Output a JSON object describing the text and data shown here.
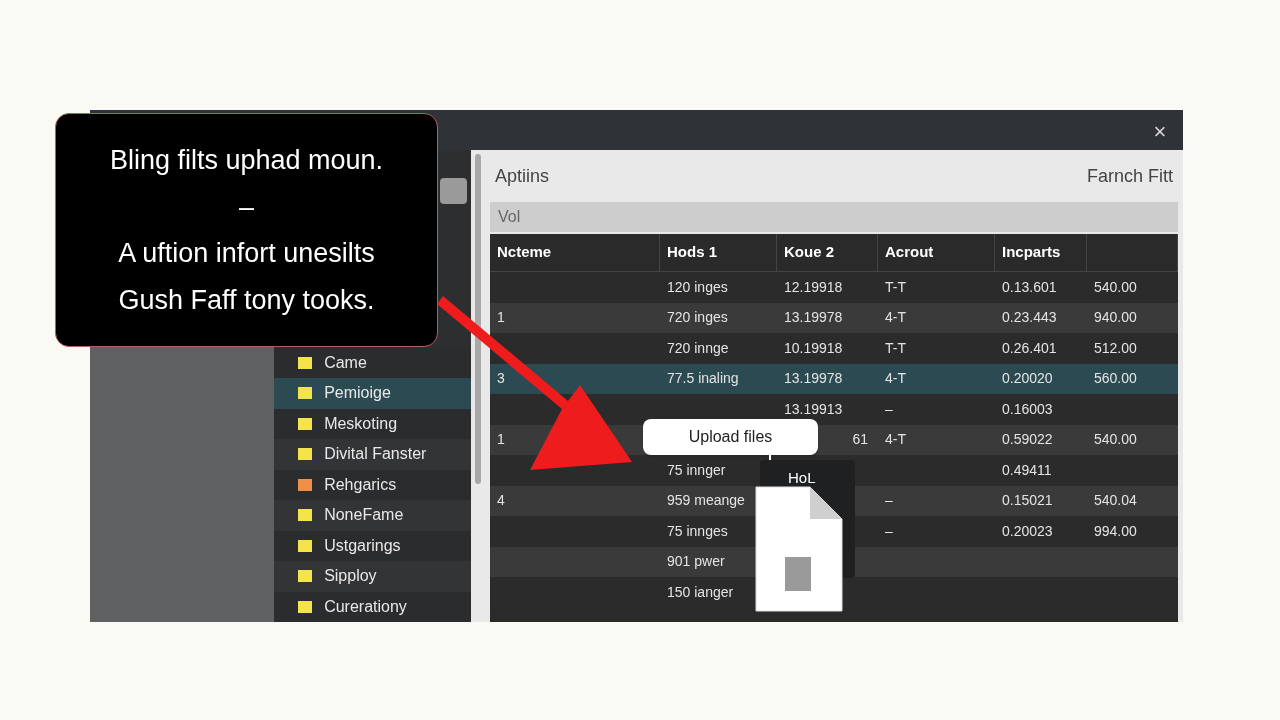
{
  "window": {
    "close": "×"
  },
  "sidebar": {
    "items": [
      {
        "label": "Came",
        "color": "#f2e44a",
        "selected": false
      },
      {
        "label": "Pemioige",
        "color": "#f2e44a",
        "selected": true
      },
      {
        "label": "Meskoting",
        "color": "#f2e44a",
        "selected": false
      },
      {
        "label": "Divital Fanster",
        "color": "#f2e44a",
        "selected": false
      },
      {
        "label": "Rehgarics",
        "color": "#ef8f4a",
        "selected": false
      },
      {
        "label": "NoneFame",
        "color": "#f2e44a",
        "selected": false
      },
      {
        "label": "Ustgarings",
        "color": "#f2e44a",
        "selected": false
      },
      {
        "label": "Sipploy",
        "color": "#f2e44a",
        "selected": false
      },
      {
        "label": "Curerationy",
        "color": "#f2e44a",
        "selected": false
      }
    ]
  },
  "header": {
    "title": "Aptiins",
    "action": "Farnch Fitt"
  },
  "filter": {
    "value": "Vol"
  },
  "table": {
    "columns": [
      "Ncteme",
      "Hods 1",
      "Koue 2",
      "Acrout",
      "Incparts"
    ],
    "rows": [
      {
        "cells": [
          "",
          "120 inges",
          "12.19918",
          "T-T",
          "0.13.601",
          "540.00"
        ],
        "selected": false
      },
      {
        "cells": [
          "1",
          "720 inges",
          "13.19978",
          "4-T",
          "0.23.443",
          "940.00"
        ],
        "selected": false
      },
      {
        "cells": [
          "",
          "720 innge",
          "10.19918",
          "T-T",
          "0.26.401",
          "512.00"
        ],
        "selected": false
      },
      {
        "cells": [
          "3",
          "77.5 inaling",
          "13.19978",
          "4-T",
          "0.20020",
          "560.00"
        ],
        "selected": true
      },
      {
        "cells": [
          "",
          "",
          "13.19913",
          "–",
          "0.16003",
          ""
        ],
        "selected": false
      },
      {
        "cells": [
          "1",
          "",
          "61",
          "4-T",
          "0.59022",
          "540.00"
        ],
        "selected": false
      },
      {
        "cells": [
          "",
          "75 innger",
          "",
          "",
          "0.49411",
          ""
        ],
        "selected": false
      },
      {
        "cells": [
          "4",
          "959 meange",
          "",
          "–",
          "0.15021",
          "540.04"
        ],
        "selected": false
      },
      {
        "cells": [
          "",
          "75 innges",
          "",
          "–",
          "0.20023",
          "994.00"
        ],
        "selected": false
      },
      {
        "cells": [
          "",
          "901 pwer",
          "",
          "",
          "",
          ""
        ],
        "selected": false
      },
      {
        "cells": [
          "",
          "150 ianger",
          "",
          "",
          "",
          ""
        ],
        "selected": false
      }
    ]
  },
  "callout": {
    "lines": [
      "Bling filts uphad moun.",
      "–",
      "A uftion infort unesilts",
      "Gush Faff tony tooks."
    ]
  },
  "tooltip": {
    "label": "Upload files"
  },
  "drag_preview": {
    "label": "HoL"
  }
}
